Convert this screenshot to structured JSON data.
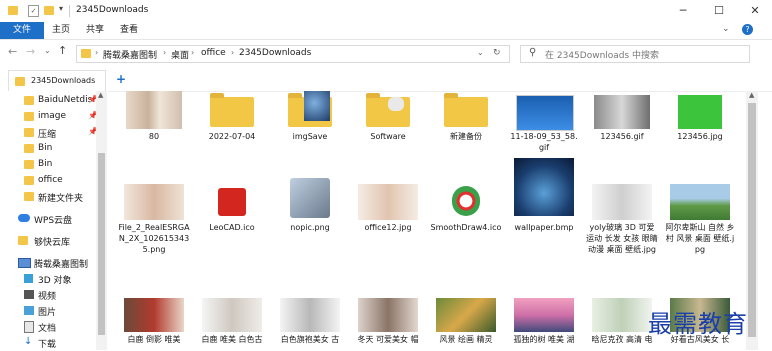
{
  "window": {
    "title": "2345Downloads",
    "controls": [
      "minimize-icon",
      "maximize-icon",
      "close-icon"
    ]
  },
  "ribbon": {
    "tabs": [
      {
        "label": "文件",
        "active": true
      },
      {
        "label": "主页",
        "active": false
      },
      {
        "label": "共享",
        "active": false
      },
      {
        "label": "查看",
        "active": false
      }
    ]
  },
  "address": {
    "crumbs": [
      "腾载桑嘉图制",
      "桌面",
      "office",
      "2345Downloads"
    ]
  },
  "search": {
    "placeholder": "在 2345Downloads 中搜索"
  },
  "folder_tab": {
    "label": "2345Downloads",
    "add": "+"
  },
  "sidebar": {
    "items": [
      {
        "label": "BaiduNetdis",
        "icon": "folder-icon",
        "pinned": true
      },
      {
        "label": "image",
        "icon": "folder-icon",
        "pinned": true
      },
      {
        "label": "压缩",
        "icon": "folder-icon",
        "pinned": true
      },
      {
        "label": "Bin",
        "icon": "folder-icon",
        "pinned": false
      },
      {
        "label": "Bin",
        "icon": "folder-icon",
        "pinned": false
      },
      {
        "label": "office",
        "icon": "folder-icon",
        "pinned": false
      },
      {
        "label": "新建文件夹",
        "icon": "folder-icon",
        "pinned": false
      },
      {
        "label": "WPS云盘",
        "icon": "cloud-icon",
        "pinned": false
      },
      {
        "label": "够快云库",
        "icon": "folder-icon",
        "pinned": false
      },
      {
        "label": "腾载桑嘉图制",
        "icon": "computer-icon",
        "pinned": false
      },
      {
        "label": "3D 对象",
        "icon": "cube-icon",
        "pinned": false
      },
      {
        "label": "视频",
        "icon": "video-icon",
        "pinned": false
      },
      {
        "label": "图片",
        "icon": "picture-icon",
        "pinned": false
      },
      {
        "label": "文档",
        "icon": "document-icon",
        "pinned": false
      },
      {
        "label": "下载",
        "icon": "download-icon",
        "pinned": false
      }
    ]
  },
  "files_row1": [
    {
      "name": "80",
      "kind": "image"
    },
    {
      "name": "2022-07-04",
      "kind": "folder"
    },
    {
      "name": "imgSave",
      "kind": "folder"
    },
    {
      "name": "Software",
      "kind": "folder"
    },
    {
      "name": "新建备份",
      "kind": "folder"
    },
    {
      "name": "11-18-09_53_58.gif",
      "kind": "image"
    },
    {
      "name": "123456.gif",
      "kind": "image"
    },
    {
      "name": "123456.jpg",
      "kind": "image"
    }
  ],
  "files_row2": [
    {
      "name": "File_2_RealESRGAN_2X_1026153435.png",
      "kind": "image"
    },
    {
      "name": "LeoCAD.ico",
      "kind": "icon"
    },
    {
      "name": "nopic.png",
      "kind": "icon"
    },
    {
      "name": "office12.jpg",
      "kind": "image"
    },
    {
      "name": "SmoothDraw4.ico",
      "kind": "icon"
    },
    {
      "name": "wallpaper.bmp",
      "kind": "image"
    },
    {
      "name": "yoly玻璃 3D 可爱 运动 长发 女孩 眼睛 动漫 桌面 壁纸.jpg",
      "kind": "image"
    },
    {
      "name": "阿尔卑斯山 自然 乡村 风景 桌面 壁纸.jpg",
      "kind": "image"
    }
  ],
  "files_row3": [
    {
      "name": "白鹿 倒影 唯美",
      "kind": "image"
    },
    {
      "name": "白鹿 唯美 白色古",
      "kind": "image"
    },
    {
      "name": "白色旗袍美女 古",
      "kind": "image"
    },
    {
      "name": "冬天 可爱美女 帽",
      "kind": "image"
    },
    {
      "name": "风景 绘画 精灵",
      "kind": "image"
    },
    {
      "name": "孤独的树 唯美 湖",
      "kind": "image"
    },
    {
      "name": "晗尼克孜 高清 电",
      "kind": "image"
    },
    {
      "name": "好看古风美女 长",
      "kind": "image"
    }
  ],
  "watermark": "最需教育",
  "colors": {
    "accent": "#1e6fc7",
    "folder": "#f2c746",
    "watermark": "#1b3fa8"
  }
}
